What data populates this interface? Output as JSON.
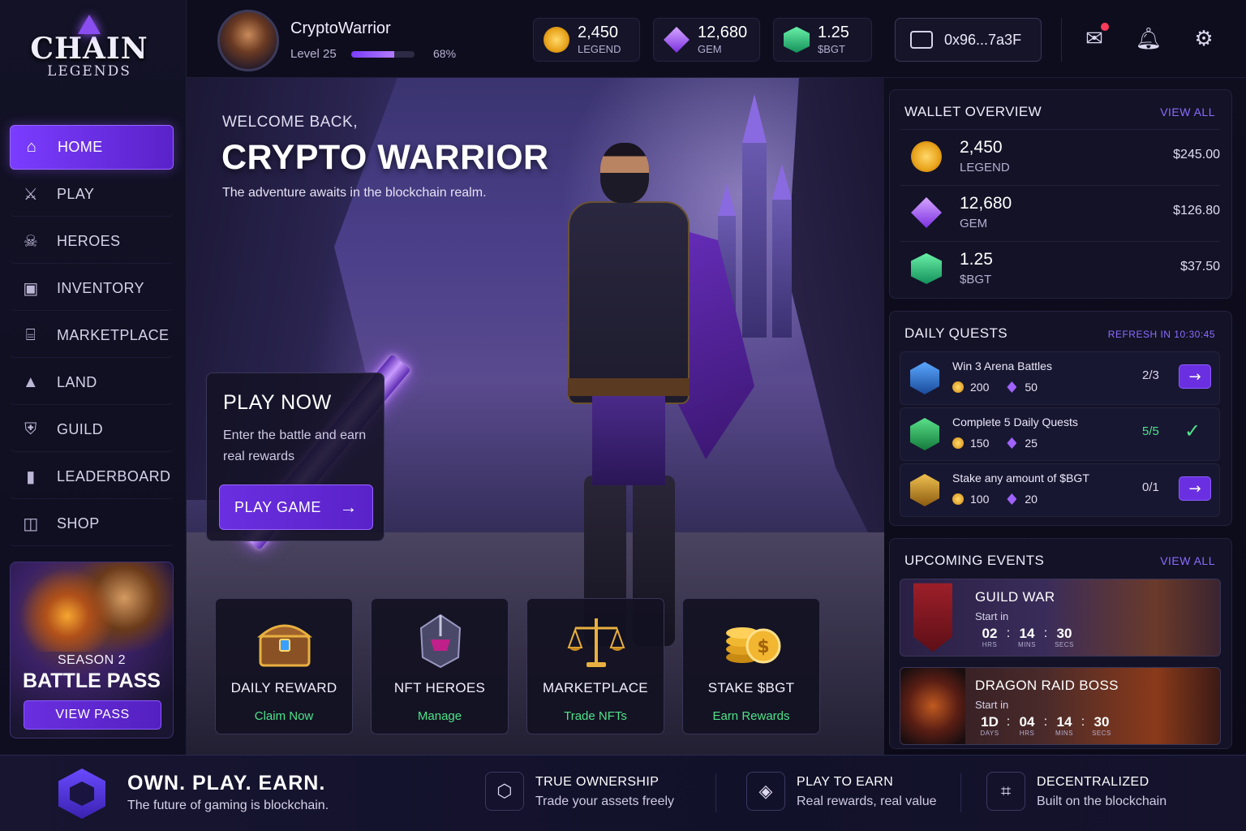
{
  "logo": {
    "title": "CHAIN",
    "subtitle": "LEGENDS"
  },
  "sidebar": {
    "items": [
      {
        "label": "HOME",
        "icon": "home-icon",
        "active": true
      },
      {
        "label": "PLAY",
        "icon": "crossed-swords-icon"
      },
      {
        "label": "HEROES",
        "icon": "skull-icon"
      },
      {
        "label": "INVENTORY",
        "icon": "chest-icon"
      },
      {
        "label": "MARKETPLACE",
        "icon": "store-icon"
      },
      {
        "label": "LAND",
        "icon": "mountain-icon"
      },
      {
        "label": "GUILD",
        "icon": "shield-icon"
      },
      {
        "label": "LEADERBOARD",
        "icon": "bar-chart-icon"
      },
      {
        "label": "SHOP",
        "icon": "shopping-bag-icon"
      }
    ],
    "battle_pass": {
      "season": "SEASON 2",
      "title": "BATTLE PASS",
      "button": "VIEW PASS"
    }
  },
  "header": {
    "player_name": "CryptoWarrior",
    "level_label": "Level 25",
    "xp_percent_label": "68%",
    "xp_fraction": 0.68,
    "currencies": [
      {
        "value": "2,450",
        "symbol": "LEGEND",
        "icon": "legend-coin-icon"
      },
      {
        "value": "12,680",
        "symbol": "GEM",
        "icon": "gem-icon"
      },
      {
        "value": "1.25",
        "symbol": "$BGT",
        "icon": "bgt-token-icon"
      }
    ],
    "wallet_address": "0x96...7a3F"
  },
  "hero": {
    "welcome": "WELCOME BACK,",
    "title": "CRYPTO WARRIOR",
    "subtitle": "The adventure awaits in the blockchain realm.",
    "play_card": {
      "title": "PLAY NOW",
      "description": "Enter the battle and earn real rewards",
      "button": "PLAY GAME"
    },
    "tiles": [
      {
        "title": "DAILY REWARD",
        "subtitle": "Claim Now",
        "icon": "treasure-chest-icon"
      },
      {
        "title": "NFT HEROES",
        "subtitle": "Manage",
        "icon": "knight-helmet-icon"
      },
      {
        "title": "MARKETPLACE",
        "subtitle": "Trade NFTs",
        "icon": "scales-icon"
      },
      {
        "title": "STAKE $BGT",
        "subtitle": "Earn Rewards",
        "icon": "coin-stack-icon"
      }
    ]
  },
  "wallet_overview": {
    "title": "WALLET OVERVIEW",
    "link": "VIEW ALL",
    "rows": [
      {
        "amount": "2,450",
        "symbol": "LEGEND",
        "usd": "$245.00",
        "color": "#e8a21a"
      },
      {
        "amount": "12,680",
        "symbol": "GEM",
        "usd": "$126.80",
        "color": "#9b55ff"
      },
      {
        "amount": "1.25",
        "symbol": "$BGT",
        "usd": "$37.50",
        "color": "#22c07a"
      }
    ]
  },
  "daily_quests": {
    "title": "DAILY QUESTS",
    "refresh": "REFRESH IN 10:30:45",
    "quests": [
      {
        "name": "Win 3 Arena Battles",
        "coins": "200",
        "gems": "50",
        "progress": "2/3",
        "done": false,
        "color": "#2a6ac8"
      },
      {
        "name": "Complete 5 Daily Quests",
        "coins": "150",
        "gems": "25",
        "progress": "5/5",
        "done": true,
        "color": "#2aa860"
      },
      {
        "name": "Stake any amount of $BGT",
        "coins": "100",
        "gems": "20",
        "progress": "0/1",
        "done": false,
        "color": "#c08a20"
      }
    ]
  },
  "upcoming_events": {
    "title": "UPCOMING EVENTS",
    "link": "VIEW ALL",
    "start_label": "Start in",
    "events": [
      {
        "name": "GUILD WAR",
        "timer": [
          {
            "n": "02",
            "l": "HRS"
          },
          {
            "n": "14",
            "l": "MINS"
          },
          {
            "n": "30",
            "l": "SECS"
          }
        ]
      },
      {
        "name": "DRAGON RAID BOSS",
        "timer": [
          {
            "n": "1D",
            "l": "DAYS"
          },
          {
            "n": "04",
            "l": "HRS"
          },
          {
            "n": "14",
            "l": "MINS"
          },
          {
            "n": "30",
            "l": "SECS"
          }
        ]
      }
    ]
  },
  "footer": {
    "title": "OWN. PLAY. EARN.",
    "subtitle": "The future of gaming is blockchain.",
    "features": [
      {
        "title": "TRUE OWNERSHIP",
        "subtitle": "Trade your assets freely",
        "icon": "ownership-icon"
      },
      {
        "title": "PLAY TO EARN",
        "subtitle": "Real rewards, real value",
        "icon": "play-to-earn-icon"
      },
      {
        "title": "DECENTRALIZED",
        "subtitle": "Built on the blockchain",
        "icon": "network-icon"
      }
    ]
  }
}
